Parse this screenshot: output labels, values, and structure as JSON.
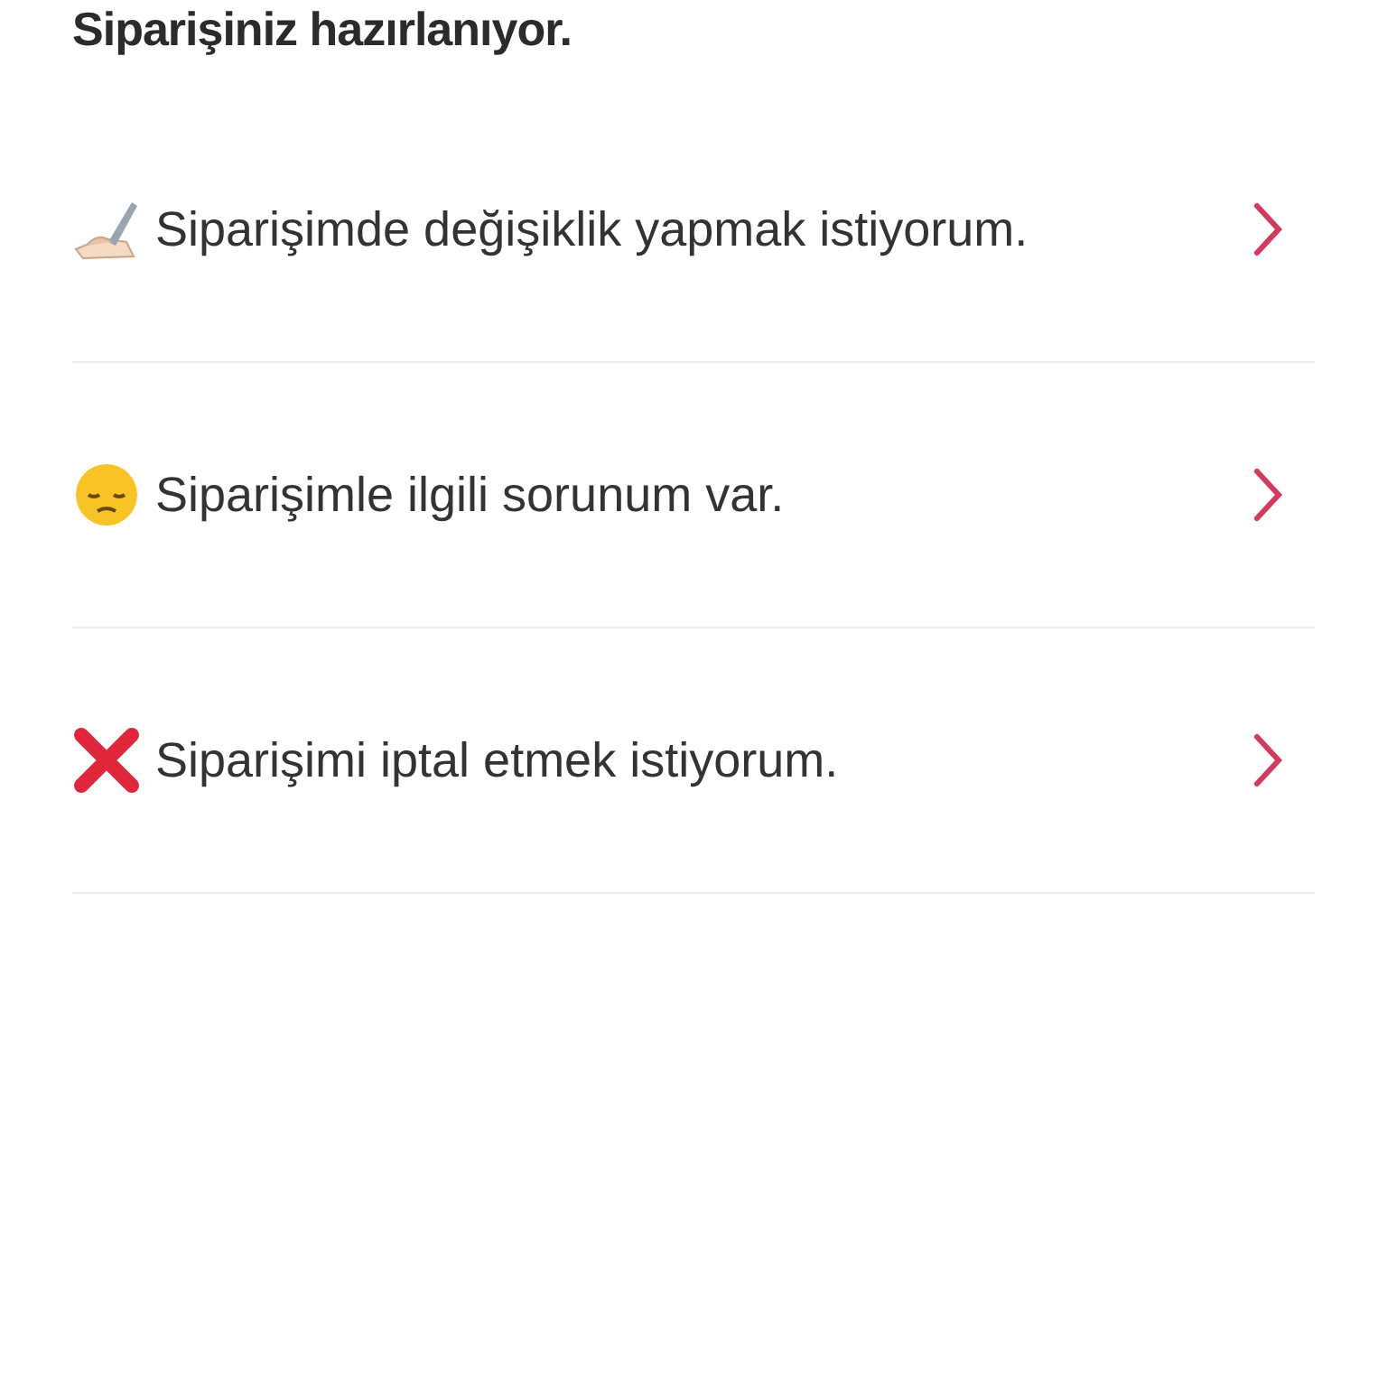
{
  "title": "Siparişiniz hazırlanıyor.",
  "options": [
    {
      "kind": "edit",
      "label": "Siparişimde değişiklik yapmak istiyorum."
    },
    {
      "kind": "problem",
      "label": "Siparişimle ilgili sorunum var."
    },
    {
      "kind": "cancel",
      "label": "Siparişimi iptal etmek istiyorum."
    }
  ]
}
